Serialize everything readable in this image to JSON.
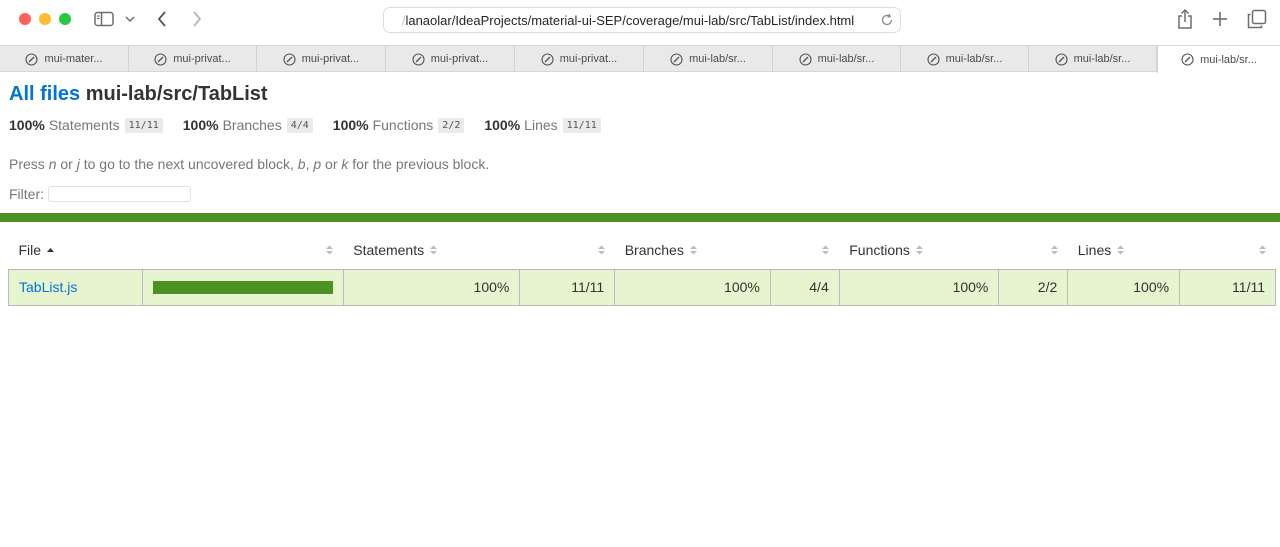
{
  "browser": {
    "address": {
      "faded_prefix": "/",
      "url_text": "lanaolar/IdeaProjects/material-ui-SEP/coverage/mui-lab/src/TabList/index.html"
    },
    "tabs": [
      {
        "label": "mui-mater..."
      },
      {
        "label": "mui-privat..."
      },
      {
        "label": "mui-privat..."
      },
      {
        "label": "mui-privat..."
      },
      {
        "label": "mui-privat..."
      },
      {
        "label": "mui-lab/sr..."
      },
      {
        "label": "mui-lab/sr..."
      },
      {
        "label": "mui-lab/sr..."
      },
      {
        "label": "mui-lab/sr..."
      },
      {
        "label": "mui-lab/sr..."
      }
    ],
    "active_tab_index": 9
  },
  "page": {
    "all_files_label": "All files",
    "path": "mui-lab/src/TabList",
    "summary": [
      {
        "pct": "100%",
        "label": "Statements",
        "fraction": "11/11"
      },
      {
        "pct": "100%",
        "label": "Branches",
        "fraction": "4/4"
      },
      {
        "pct": "100%",
        "label": "Functions",
        "fraction": "2/2"
      },
      {
        "pct": "100%",
        "label": "Lines",
        "fraction": "11/11"
      }
    ],
    "hint": {
      "t1": "Press ",
      "k1": "n",
      "t2": " or ",
      "k2": "j",
      "t3": " to go to the next uncovered block, ",
      "k3": "b",
      "t4": ", ",
      "k4": "p",
      "t5": " or ",
      "k5": "k",
      "t6": " for the previous block."
    },
    "filter_label": "Filter:",
    "filter_value": "",
    "status_color": "#4d9221"
  },
  "table": {
    "headers": {
      "file": "File",
      "statements": "Statements",
      "branches": "Branches",
      "functions": "Functions",
      "lines": "Lines"
    },
    "rows": [
      {
        "file": "TabList.js",
        "coverage_fraction": 1.0,
        "statements_pct": "100%",
        "statements_frac": "11/11",
        "branches_pct": "100%",
        "branches_frac": "4/4",
        "functions_pct": "100%",
        "functions_frac": "2/2",
        "lines_pct": "100%",
        "lines_frac": "11/11"
      }
    ]
  }
}
